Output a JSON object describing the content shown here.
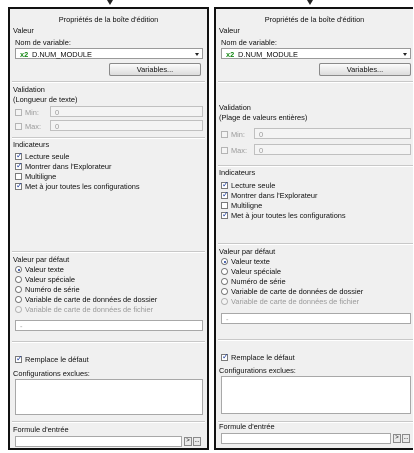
{
  "panels": [
    {
      "title": "Propriétés de la boîte d'édition",
      "valeur_label": "Valeur",
      "variable_name_label": "Nom de variable:",
      "variable_prefix": "x2",
      "variable_value": "D.NUM_MODULE",
      "variables_button": "Variables...",
      "validation_label": "Validation",
      "validation_type": "(Longueur de texte)",
      "min_label": "Min:",
      "min_value": "0",
      "max_label": "Max:",
      "max_value": "0",
      "indicators_label": "Indicateurs",
      "cb_readonly": "Lecture seule",
      "cb_explorer": "Montrer dans l'Explorateur",
      "cb_multiline": "Multiligne",
      "cb_update": "Met à jour toutes les configurations",
      "default_label": "Valeur par défaut",
      "r_text": "Valeur texte",
      "r_special": "Valeur spéciale",
      "r_serial": "Numéro de série",
      "r_folder": "Variable de carte de données de dossier",
      "r_file": "Variable de carte de données de fichier",
      "default_value": "-",
      "cb_replace": "Remplace le défaut",
      "excluded_label": "Configurations exclues:",
      "formula_label": "Formule d'entrée",
      "formula_btn1": ">",
      "formula_btn2": "..."
    },
    {
      "title": "Propriétés de la boîte d'édition",
      "valeur_label": "Valeur",
      "variable_name_label": "Nom de variable:",
      "variable_prefix": "x2",
      "variable_value": "D.NUM_MODULE",
      "variables_button": "Variables...",
      "validation_label": "Validation",
      "validation_type": "(Plage de valeurs entières)",
      "min_label": "Min:",
      "min_value": "0",
      "max_label": "Max:",
      "max_value": "0",
      "indicators_label": "Indicateurs",
      "cb_readonly": "Lecture seule",
      "cb_explorer": "Montrer dans l'Explorateur",
      "cb_multiline": "Multiligne",
      "cb_update": "Met à jour toutes les configurations",
      "default_label": "Valeur par défaut",
      "r_text": "Valeur texte",
      "r_special": "Valeur spéciale",
      "r_serial": "Numéro de série",
      "r_folder": "Variable de carte de données de dossier",
      "r_file": "Variable de carte de données de fichier",
      "default_value": "-",
      "cb_replace": "Remplace le défaut",
      "excluded_label": "Configurations exclues:",
      "formula_label": "Formule d'entrée",
      "formula_btn1": ">",
      "formula_btn2": "..."
    }
  ],
  "colors": {
    "accent_check": "#1a3a9a",
    "variable_prefix": "#1a8a1a"
  }
}
